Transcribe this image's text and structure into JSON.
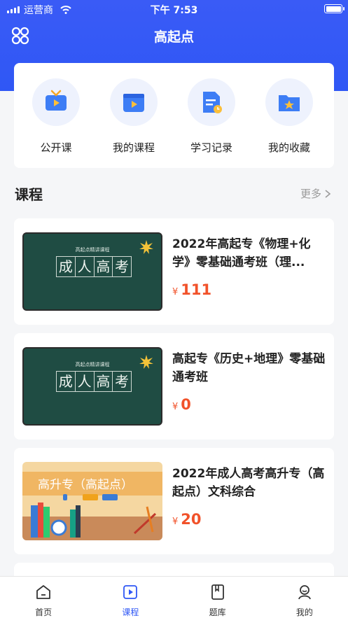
{
  "status_bar": {
    "carrier": "运营商",
    "time": "下午 7:53"
  },
  "header": {
    "title": "高起点"
  },
  "quick_links": [
    {
      "label": "公开课",
      "icon": "tv-icon"
    },
    {
      "label": "我的课程",
      "icon": "video-folder-icon"
    },
    {
      "label": "学习记录",
      "icon": "study-record-icon"
    },
    {
      "label": "我的收藏",
      "icon": "favorites-folder-icon"
    }
  ],
  "courses_section": {
    "title": "课程",
    "more_label": "更多"
  },
  "courses": [
    {
      "title": "2022年高起专《物理+化学》零基础通考班（理...",
      "currency": "¥",
      "price": "111",
      "thumb_small": "高起点精讲课程",
      "thumb_big": [
        "成",
        "人",
        "高",
        "考"
      ]
    },
    {
      "title": "高起专《历史+地理》零基础通考班",
      "currency": "¥",
      "price": "0",
      "thumb_small": "高起点精讲课程",
      "thumb_big": [
        "成",
        "人",
        "高",
        "考"
      ]
    },
    {
      "title": "2022年成人高考高升专（高起点）文科综合",
      "currency": "¥",
      "price": "20",
      "thumb_banner": "高升专（高起点）"
    }
  ],
  "tab_bar": [
    {
      "label": "首页",
      "icon": "home-icon",
      "active": false
    },
    {
      "label": "课程",
      "icon": "course-icon",
      "active": true
    },
    {
      "label": "题库",
      "icon": "question-bank-icon",
      "active": false
    },
    {
      "label": "我的",
      "icon": "profile-icon",
      "active": false
    }
  ],
  "colors": {
    "primary": "#2f57f5",
    "price": "#f1522a",
    "background": "#f5f6f8"
  }
}
